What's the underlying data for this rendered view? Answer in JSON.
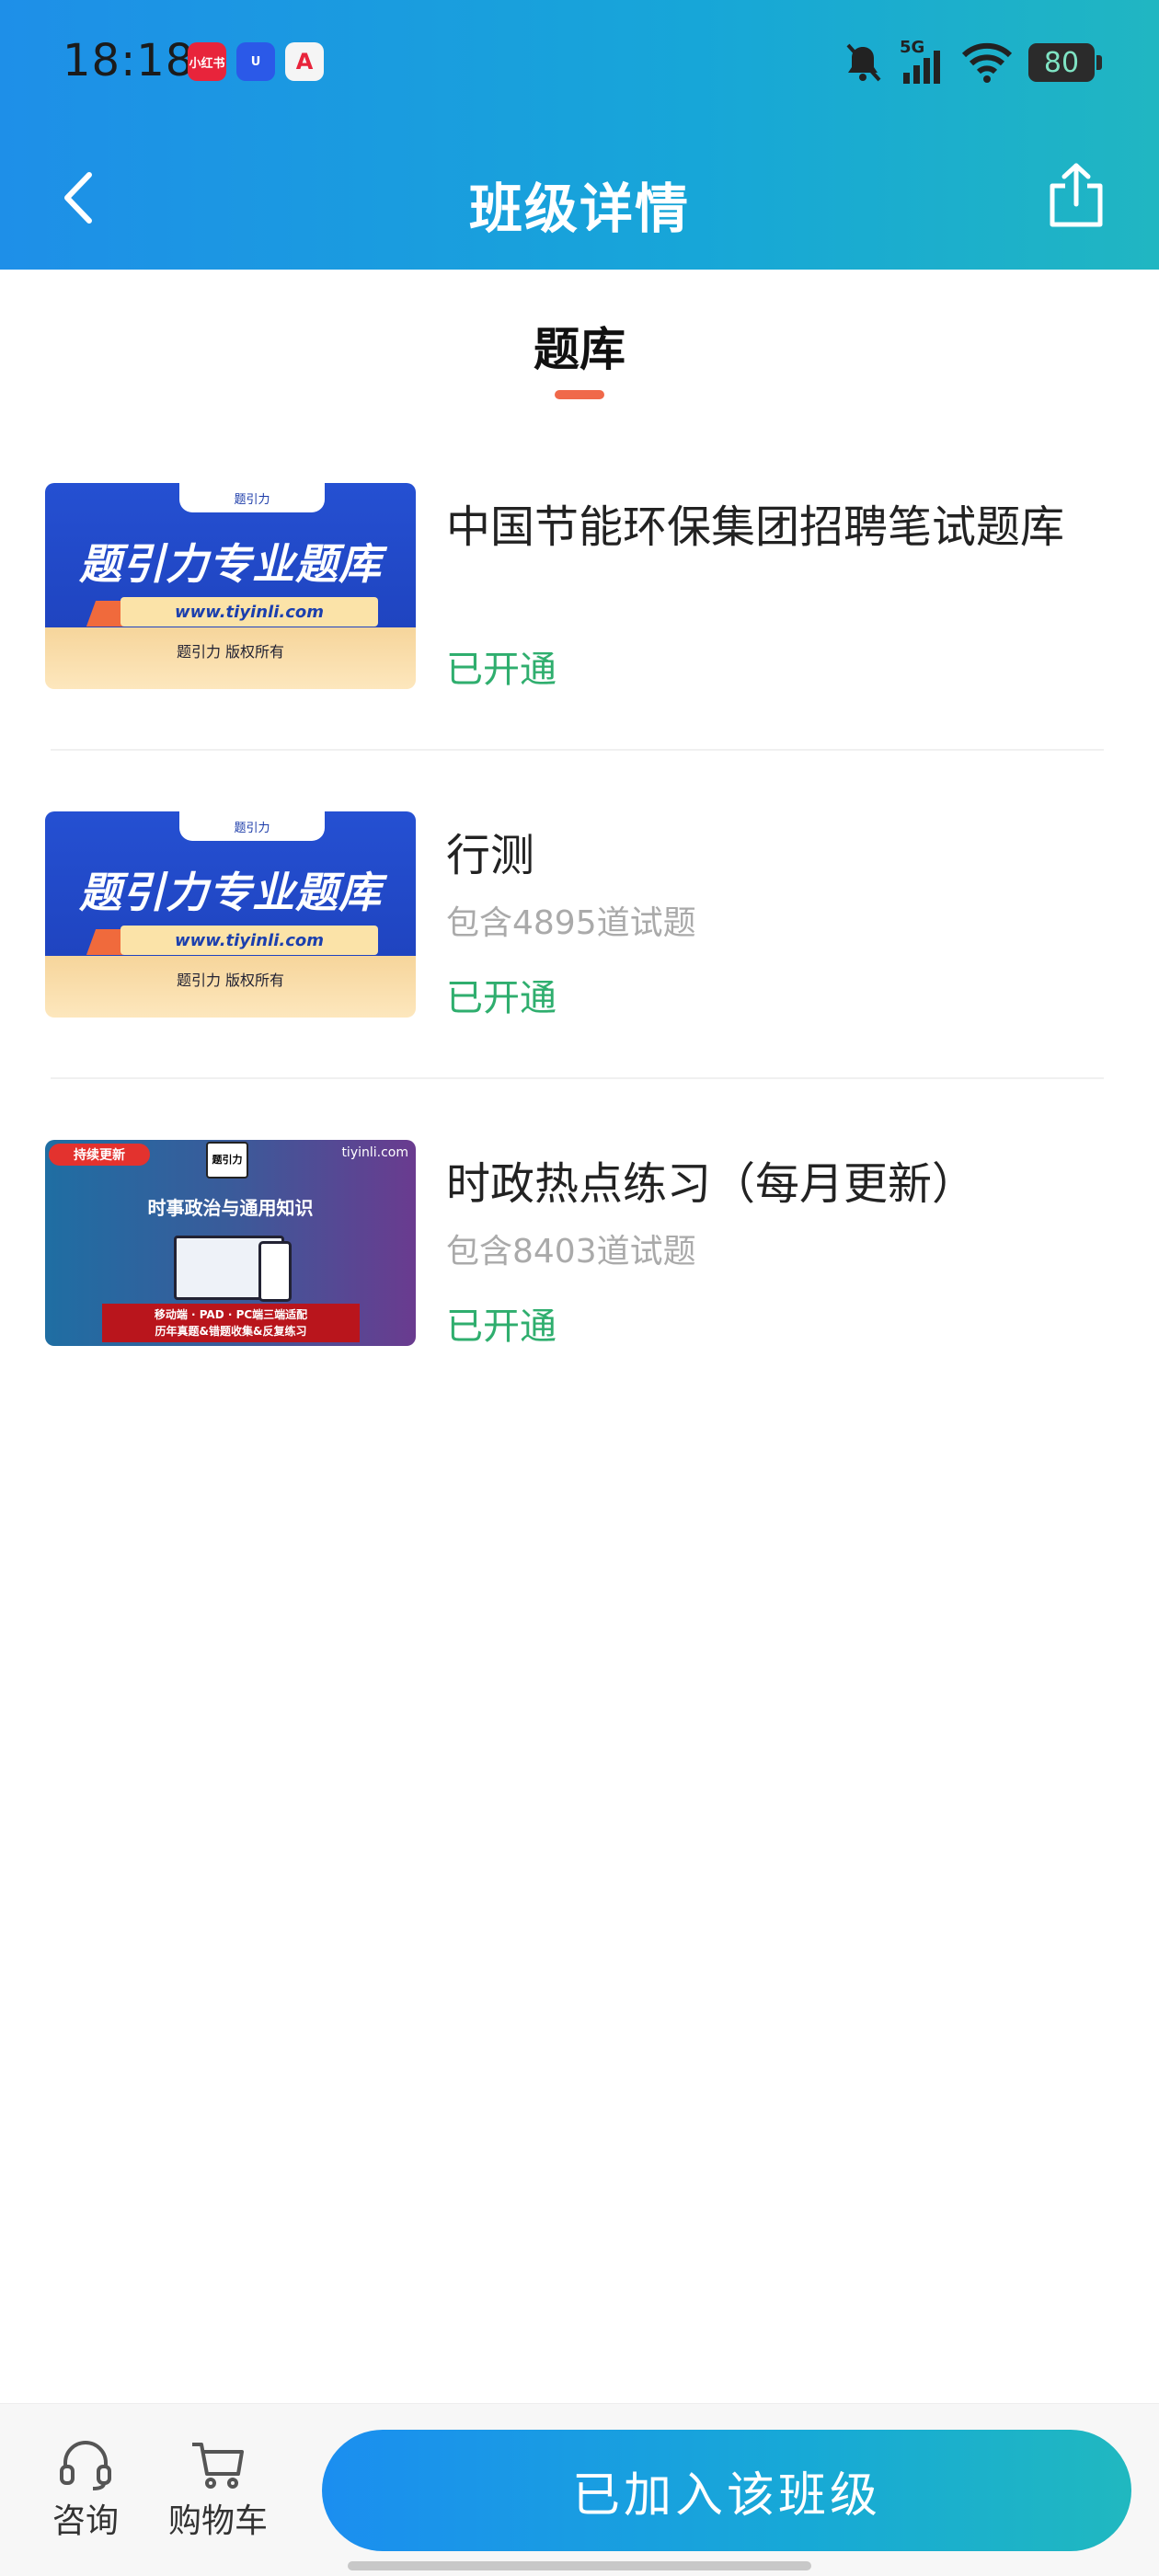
{
  "status_bar": {
    "time": "18:18",
    "apps": [
      {
        "name": "xiaohongshu-app-icon",
        "label": "小红书",
        "color": "#e8243b"
      },
      {
        "name": "shield-app-icon",
        "label": "U",
        "color": "#2b59e8"
      },
      {
        "name": "a-app-icon",
        "label": "A",
        "color": "#f5f5f5"
      }
    ],
    "network": "5G",
    "battery": "80"
  },
  "nav": {
    "title": "班级详情"
  },
  "tab": {
    "label": "题库"
  },
  "items": [
    {
      "title": "中国节能环保集团招聘笔试题库",
      "count": "",
      "status": "已开通",
      "thumb": {
        "tab": "题引力",
        "big": "题引力专业题库",
        "url": "www.tiyinli.com",
        "copy": "题引力 版权所有"
      }
    },
    {
      "title": "行测",
      "count": "包含4895道试题",
      "status": "已开通",
      "thumb": {
        "tab": "题引力",
        "big": "题引力专业题库",
        "url": "www.tiyinli.com",
        "copy": "题引力 版权所有"
      }
    },
    {
      "title": "时政热点练习（每月更新）",
      "count": "包含8403道试题",
      "status": "已开通",
      "thumb": {
        "badge": "持续更新",
        "logo": "题引力",
        "site": "tiyinli.com",
        "head": "时事政治与通用知识",
        "bottom1": "移动端 · PAD · PC端三端适配",
        "bottom2": "历年真题&错题收集&反复练习"
      }
    }
  ],
  "bottom_bar": {
    "consult": "咨询",
    "cart": "购物车",
    "join": "已加入该班级"
  },
  "colors": {
    "accent": "#1b8ef0",
    "status_green": "#2fae6e",
    "tab_underline": "#f0694a"
  }
}
